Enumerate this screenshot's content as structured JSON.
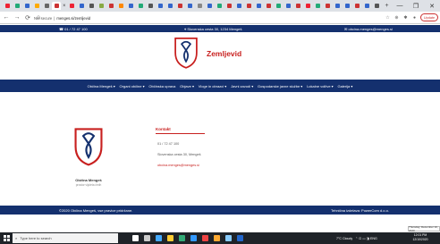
{
  "browser": {
    "tab_colors": [
      "#e23",
      "#2a7",
      "#36c",
      "#fa0",
      "#666",
      "#c33",
      "#e23",
      "#36c",
      "#555",
      "#8a4",
      "#c33",
      "#f80",
      "#36c",
      "#2a7",
      "#555",
      "#36c",
      "#36c",
      "#c33",
      "#36c",
      "#888",
      "#36c",
      "#2a7",
      "#c33",
      "#36c",
      "#c33",
      "#36c",
      "#c33",
      "#2a7",
      "#36c",
      "#c33",
      "#e23",
      "#2a7",
      "#c33",
      "#36c",
      "#36c",
      "#c33",
      "#36c",
      "#555"
    ],
    "active_tab_index": 5,
    "close_tab": "×",
    "new_tab": "+",
    "window_buttons": [
      "—",
      "❐",
      "✕"
    ],
    "nav_icons": [
      "←",
      "→",
      "⟳",
      "⌂"
    ],
    "security": "Not secure",
    "url": "menges.si/zemljevid",
    "right_icons": [
      "☆",
      "⊕",
      "✱",
      "●"
    ],
    "update_label": "Update"
  },
  "site": {
    "phone": "01 / 72 47 100",
    "address": "Slovenska cesta 30, 1234 Mengeš",
    "email": "obcina.menges@menges.si",
    "page_title": "Zemljevid",
    "nav": [
      "Občina Mengeš ▾",
      "Organi občine ▾",
      "Občinska uprava",
      "Objave ▾",
      "Vloge in obrazci ▾",
      "Javni zavodi ▾",
      "Gospodarske javne službe ▾",
      "Lokalne volitve ▾",
      "Galerija ▾"
    ],
    "org_name": "Občina Mengeš",
    "org_sub": "prostor vijoleta črnih",
    "contact_title": "Kontakt",
    "contact_phone": "01 / 72 47 100",
    "contact_address": "Slovenska cesta 30, Mengeš",
    "contact_email": "obcina.menges@menges.si",
    "footer_left": "©2020 Občina Mengeš, vse pravice pridržane.",
    "footer_right": "Tehnična izdelava: PowerCom d.o.o."
  },
  "tooltip": "Thursday, December 10, 2020",
  "taskbar": {
    "search_placeholder": "Type here to search",
    "app_colors": [
      "#fff",
      "#ccc",
      "#4af",
      "#fc3",
      "#3a7",
      "#39f",
      "#e44",
      "#fa3",
      "#8cf",
      "#26c"
    ],
    "weather": "7°C Cloudy",
    "tray_icons": "⌃ ⊡ ▭ ◨ ENG",
    "time": "12:01 PM",
    "date": "12/10/2020"
  },
  "colors": {
    "navy": "#14306e",
    "red": "#c8201f"
  }
}
